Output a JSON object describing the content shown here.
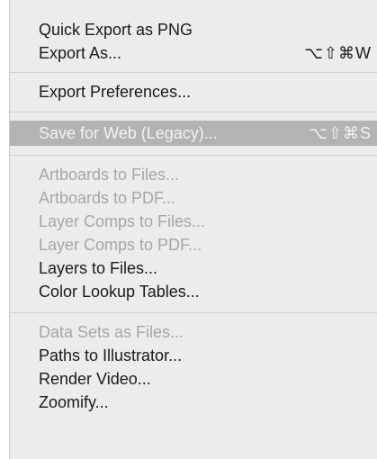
{
  "menu": {
    "groups": [
      {
        "items": [
          {
            "label": "Quick Export as PNG",
            "shortcut": "",
            "enabled": true
          },
          {
            "label": "Export As...",
            "shortcut": "⌥⇧⌘W",
            "enabled": true
          }
        ]
      },
      {
        "items": [
          {
            "label": "Export Preferences...",
            "shortcut": "",
            "enabled": true
          }
        ]
      },
      {
        "items": [
          {
            "label": "Save for Web (Legacy)...",
            "shortcut": "⌥⇧⌘S",
            "enabled": true,
            "highlighted": true
          }
        ]
      },
      {
        "items": [
          {
            "label": "Artboards to Files...",
            "shortcut": "",
            "enabled": false
          },
          {
            "label": "Artboards to PDF...",
            "shortcut": "",
            "enabled": false
          },
          {
            "label": "Layer Comps to Files...",
            "shortcut": "",
            "enabled": false
          },
          {
            "label": "Layer Comps to PDF...",
            "shortcut": "",
            "enabled": false
          },
          {
            "label": "Layers to Files...",
            "shortcut": "",
            "enabled": true
          },
          {
            "label": "Color Lookup Tables...",
            "shortcut": "",
            "enabled": true
          }
        ]
      },
      {
        "items": [
          {
            "label": "Data Sets as Files...",
            "shortcut": "",
            "enabled": false
          },
          {
            "label": "Paths to Illustrator...",
            "shortcut": "",
            "enabled": true
          },
          {
            "label": "Render Video...",
            "shortcut": "",
            "enabled": true
          },
          {
            "label": "Zoomify...",
            "shortcut": "",
            "enabled": true
          }
        ]
      }
    ]
  }
}
